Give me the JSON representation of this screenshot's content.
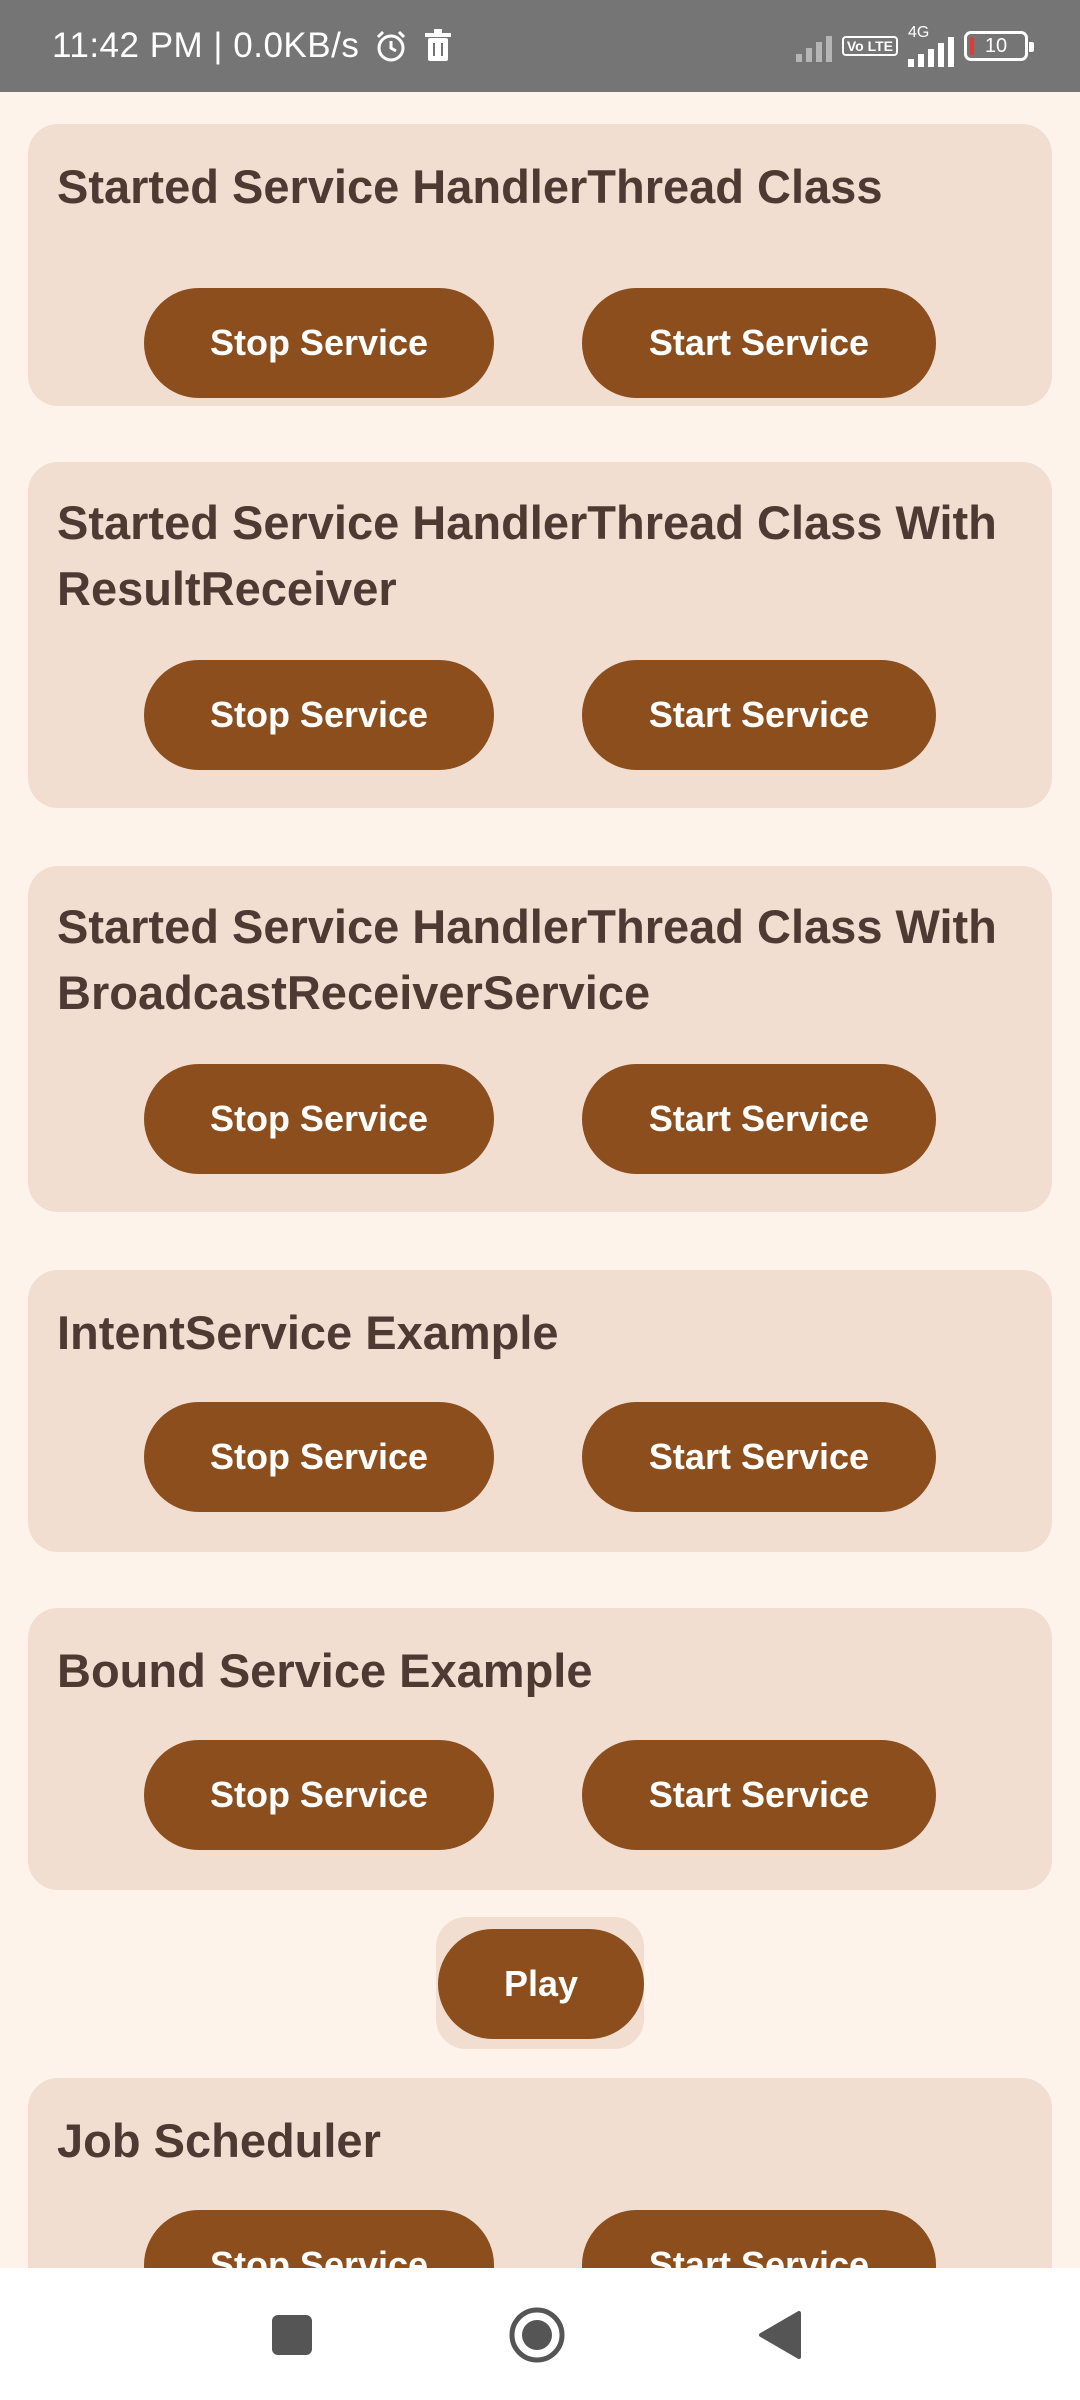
{
  "status_bar": {
    "time_speed": "11:42 PM | 0.0KB/s",
    "volte_label": "Vo LTE",
    "network_label": "4G",
    "battery_level": "10",
    "icons": [
      "alarm-icon",
      "trash-icon",
      "signal-muted-icon",
      "volte-icon",
      "signal-4g-icon",
      "battery-icon"
    ]
  },
  "cards": [
    {
      "title": "Started Service HandlerThread Class",
      "stop_label": "Stop Service",
      "start_label": "Start Service"
    },
    {
      "title": "Started Service HandlerThread Class With ResultReceiver",
      "stop_label": "Stop Service",
      "start_label": "Start Service"
    },
    {
      "title": "Started Service HandlerThread Class With BroadcastReceiverService",
      "stop_label": "Stop Service",
      "start_label": "Start Service"
    },
    {
      "title": "IntentService Example",
      "stop_label": "Stop Service",
      "start_label": "Start Service"
    },
    {
      "title": "Bound Service Example",
      "stop_label": "Stop Service",
      "start_label": "Start Service"
    },
    {
      "title": "Job Scheduler",
      "stop_label": "Stop Service",
      "start_label": "Start Service"
    }
  ],
  "play_label": "Play",
  "nav_bar": {
    "icons": [
      "recents-square-icon",
      "home-circle-icon",
      "back-triangle-icon"
    ]
  },
  "colors": {
    "background": "#fdf3ea",
    "card": "#f2ddd1",
    "button": "#8b4e1c",
    "title_text": "#4e3a33",
    "status_bar": "#757575"
  }
}
